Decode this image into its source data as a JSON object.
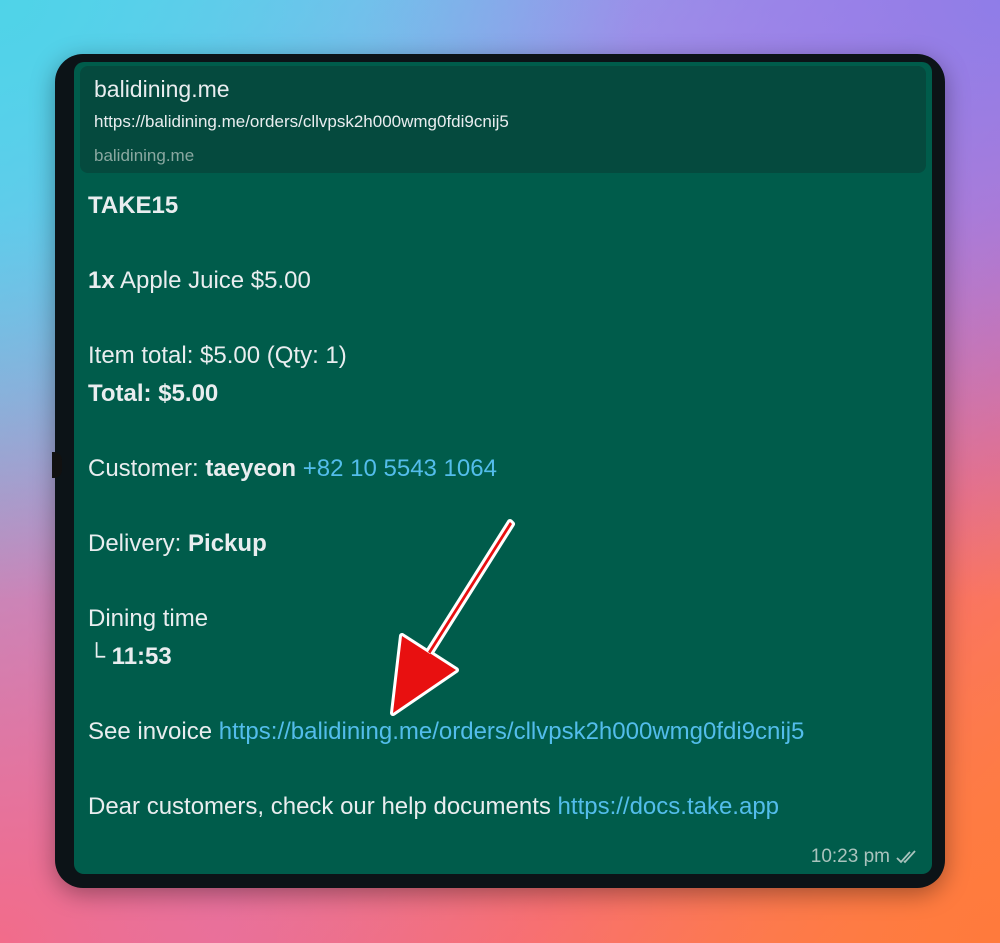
{
  "preview": {
    "title": "balidining.me",
    "url": "https://balidining.me/orders/cllvpsk2h000wmg0fdi9cnij5",
    "domain": "balidining.me"
  },
  "message": {
    "heading": "TAKE15",
    "item_qty": "1x",
    "item_text": " Apple Juice $5.00",
    "item_total": "Item total: $5.00 (Qty: 1)",
    "total": "Total: $5.00",
    "customer_label": "Customer: ",
    "customer_name": "taeyeon",
    "customer_phone": "+82 10 5543 1064",
    "delivery_label": "Delivery: ",
    "delivery_value": "Pickup",
    "dining_label": "Dining time",
    "dining_branch": "└ ",
    "dining_value": "11:53",
    "invoice_label": "See invoice ",
    "invoice_link": "https://balidining.me/orders/cllvpsk2h000wmg0fdi9cnij5",
    "help_label": "Dear customers, check our help documents ",
    "help_link": "https://docs.take.app"
  },
  "meta": {
    "time": "10:23 pm",
    "status_icon": "double-check-icon"
  },
  "colors": {
    "bubble": "#005c4b",
    "preview_bg": "#054a3e",
    "link": "#53bdeb",
    "arrow": "#e81010"
  }
}
